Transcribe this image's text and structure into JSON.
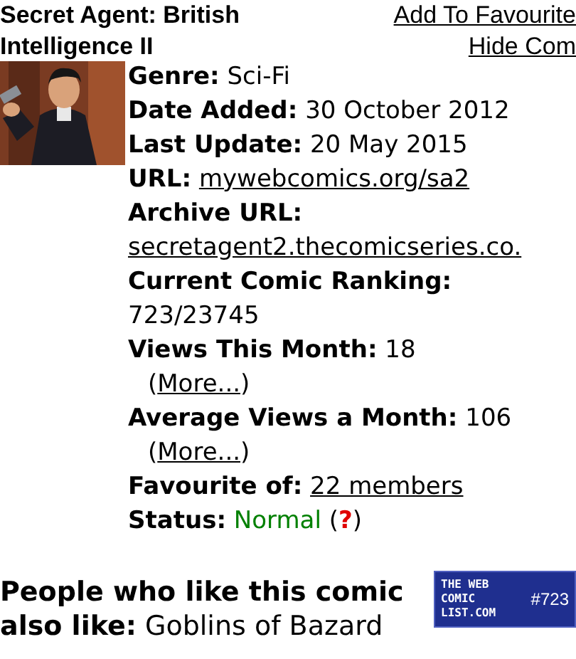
{
  "title": "Secret Agent: British Intelligence II",
  "links": [
    {
      "label": "Add To Favourite"
    },
    {
      "label": "Hide Com"
    }
  ],
  "details": [
    {
      "label": "Genre:",
      "value": "Sci-Fi",
      "kind": "text"
    },
    {
      "label": "Date Added:",
      "value": "30 October 2012",
      "kind": "text"
    },
    {
      "label": "Last Update:",
      "value": "20 May 2015",
      "kind": "text"
    },
    {
      "label": "URL:",
      "value": "mywebcomics.org/sa2",
      "kind": "link"
    },
    {
      "label": "Archive URL:",
      "value": "secretagent2.thecomicseries.co.",
      "kind": "link"
    },
    {
      "label": "Current Comic Ranking:",
      "value": "723/23745",
      "kind": "text"
    },
    {
      "label": "Views This Month:",
      "value": "18",
      "kind": "text",
      "more": {
        "open": "(",
        "label": "More...",
        "close": ")"
      }
    },
    {
      "label": "Average Views a Month:",
      "value": "106",
      "kind": "text",
      "more": {
        "open": "(",
        "label": "More...",
        "close": ")"
      }
    },
    {
      "label": "Favourite of:",
      "value": "22 members",
      "kind": "link"
    },
    {
      "label": "Status:",
      "value": "Normal",
      "kind": "status",
      "color": "#008000",
      "help": {
        "open": "(",
        "label": "?",
        "close": ")"
      }
    }
  ],
  "related": {
    "heading": "People who like this comic also like:",
    "comic": "Goblins of Bazard"
  },
  "badge": {
    "lines": [
      "THE WEB",
      "COMIC",
      "LIST.COM"
    ],
    "rank": "#723"
  }
}
